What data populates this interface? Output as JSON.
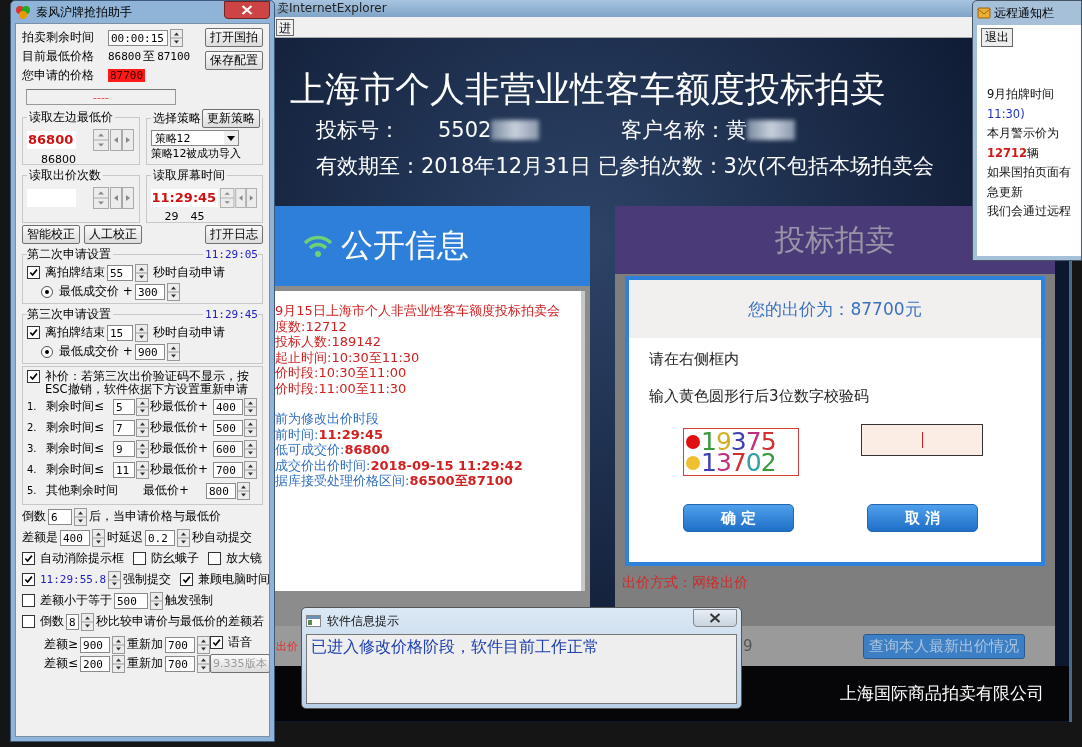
{
  "helper": {
    "title": "秦风沪牌抢拍助手",
    "countdown": {
      "label": "拍卖剩余时间",
      "value": "00:00:15"
    },
    "open_button": "打开国拍",
    "lowest": {
      "label": "目前最低价格",
      "from": "86800",
      "separator": "至",
      "to": "87100"
    },
    "save_button": "保存配置",
    "applied": {
      "label": "您申请的价格",
      "value": "87700"
    },
    "status": "----",
    "read_lowest": {
      "title": "读取左边最低价",
      "value": "86800",
      "reading": "86800"
    },
    "strategy": {
      "title": "选择策略",
      "button": "更新策略",
      "value": "策略12",
      "message": "策略12被成功导入"
    },
    "read_count": {
      "title": "读取出价次数"
    },
    "read_time": {
      "title": "读取屏幕时间",
      "value": "11:29:45",
      "readings": [
        "29",
        "45"
      ]
    },
    "buttons": [
      "智能校正",
      "人工校正",
      "打开日志"
    ],
    "rounds": [
      {
        "title": "第二次申请设置",
        "time": "11:29:05",
        "checked": true,
        "label": "离拍牌结束",
        "seconds": "55",
        "suffix": "秒时自动申请",
        "option": {
          "selected": true,
          "label": "最低成交价 +",
          "value": "300"
        }
      },
      {
        "title": "第三次申请设置",
        "time": "11:29:45",
        "checked": true,
        "label": "离拍牌结束",
        "seconds": "15",
        "suffix": "秒时自动申请",
        "option": {
          "selected": true,
          "label": "最低成交价 +",
          "value": "900"
        }
      }
    ],
    "supplement": {
      "checked": true,
      "text": "补价：若第三次出价验证码不显示，按ESC撤销，软件依据下方设置重新申请",
      "rules": [
        {
          "kind": "timed",
          "index": "1.",
          "label": "剩余时间≤",
          "seconds": "5",
          "unit": "秒最低价+",
          "value": "400"
        },
        {
          "kind": "timed",
          "index": "2.",
          "label": "剩余时间≤",
          "seconds": "7",
          "unit": "秒最低价+",
          "value": "500"
        },
        {
          "kind": "timed",
          "index": "3.",
          "label": "剩余时间≤",
          "seconds": "9",
          "unit": "秒最低价+",
          "value": "600"
        },
        {
          "kind": "timed",
          "index": "4.",
          "label": "剩余时间≤",
          "seconds": "11",
          "unit": "秒最低价+",
          "value": "700"
        },
        {
          "kind": "other",
          "index": "5.",
          "label": "其他剩余时间",
          "unit": "最低价+",
          "value": "800"
        }
      ]
    },
    "countdown_rule": {
      "prefix": "倒数",
      "value": "6",
      "suffix": "后，当申请价格与最低价"
    },
    "delay_rule": {
      "prefix": "差额是",
      "value": "400",
      "middle": "时延迟",
      "delay": "0.2",
      "suffix": "秒自动提交"
    },
    "options": [
      {
        "label": "自动消除提示框",
        "checked": true
      },
      {
        "label": "防幺蛾子",
        "checked": false
      },
      {
        "label": "放大镜",
        "checked": false
      }
    ],
    "force": {
      "checked": true,
      "time": "11:29:55.8",
      "label": "强制提交",
      "computer_time": {
        "checked": true,
        "label": "兼顾电脑时间"
      }
    },
    "trigger": {
      "checked": false,
      "label": "差额小于等于",
      "value": "500",
      "suffix": "触发强制"
    },
    "compare": {
      "checked": false,
      "label": "倒数",
      "value": "8",
      "suffix": "秒比较申请价与最低价的差额若"
    },
    "adjust": [
      {
        "label": "差额≥",
        "value": "900",
        "middle": "重新加",
        "add": "700"
      },
      {
        "label": "差额≤",
        "value": "200",
        "middle": "重新加",
        "add": "700"
      }
    ],
    "voice": {
      "checked": true,
      "label": "语音"
    },
    "version_button": "9.335版本"
  },
  "browser": {
    "title": "卖InternetExplorer",
    "toolbar_button": "进",
    "heading": "上海市个人非营业性客车额度投标拍卖",
    "bid_no_label": "投标号：",
    "bid_no": "5502",
    "customer_label": "客户名称：",
    "customer": "黄",
    "validity": "有效期至：2018年12月31日 已参拍次数：3次(不包括本场拍卖会",
    "public_title": "公开信息",
    "info_lines": [
      {
        "kind": "notice",
        "text": "9月15日上海市个人非营业性客车额度投标拍卖会"
      },
      {
        "kind": "notice",
        "text": "度数:12712"
      },
      {
        "kind": "notice",
        "text": "投标人数:189142"
      },
      {
        "kind": "notice",
        "text": "起止时间:10:30至11:30"
      },
      {
        "kind": "notice",
        "text": "价时段:10:30至11:00"
      },
      {
        "kind": "notice",
        "text": "价时段:11:00至11:30"
      },
      {
        "kind": "gap"
      },
      {
        "kind": "field",
        "label": "前为修改出价时段"
      },
      {
        "kind": "field",
        "label": "前时间:",
        "value": "11:29:45"
      },
      {
        "kind": "field",
        "label": "低可成交价:",
        "value": "86800"
      },
      {
        "kind": "field",
        "label": "成交价出价时间:",
        "value": "2018-09-15 11:29:42"
      },
      {
        "kind": "field",
        "label": "据库接受处理价格区间:",
        "value": "86500至87100"
      }
    ],
    "auction_title": "投标拍卖",
    "dialog": {
      "price": "您的出价为：87700元",
      "instructions": [
        "请在右侧框内",
        "输入黄色圆形行后3位数字校验码"
      ],
      "captcha_rows": [
        {
          "color": "#e01010",
          "digits": "19375"
        },
        {
          "color": "#f0c030",
          "digits": "13702"
        }
      ],
      "confirm": "确 定",
      "cancel": "取 消"
    },
    "bid_method_label": "出价方式：",
    "bid_method": "网络出价",
    "bottom_left": "出价",
    "bottom_mid": "9",
    "query_button": "查询本人最新出价情况",
    "footer": "上海国际商品拍卖有限公司"
  },
  "popup": {
    "title": "软件信息提示",
    "message": "已进入修改价格阶段，软件目前工作正常"
  },
  "notice": {
    "title": "远程通知栏",
    "exit_button": "退出",
    "lines": [
      {
        "kind": "plain",
        "text": "9月拍牌时间"
      },
      {
        "kind": "blue",
        "text": "11:30)"
      },
      {
        "kind": "plain",
        "text": "本月警示价为"
      },
      {
        "kind": "plain",
        "text": "**12712**辆"
      },
      {
        "kind": "plain",
        "text": "如果国拍页面有"
      },
      {
        "kind": "plain",
        "text": "急更新"
      },
      {
        "kind": "plain",
        "text": "我们会通过远程"
      }
    ]
  }
}
